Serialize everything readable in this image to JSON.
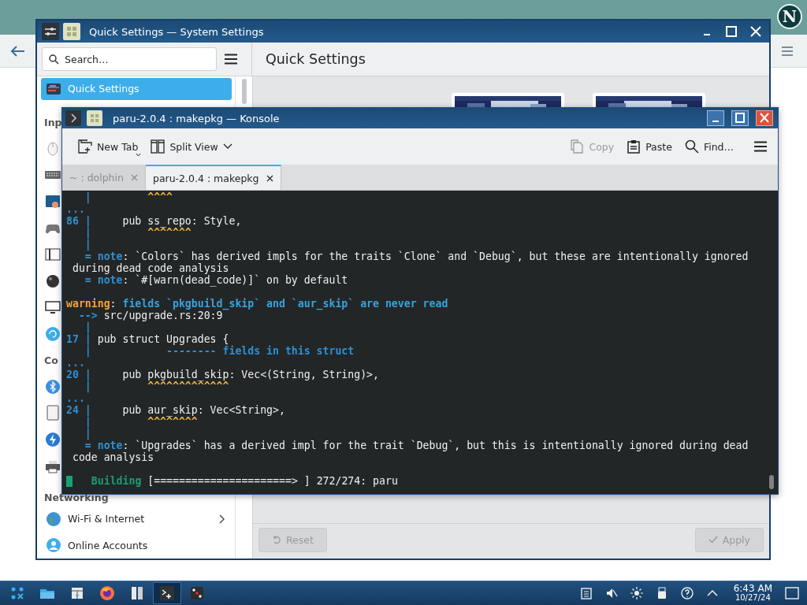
{
  "browser": {
    "avatar": "N"
  },
  "settings_window": {
    "title": "Quick Settings — System Settings",
    "search": {
      "placeholder": "Search…"
    },
    "page_title": "Quick Settings",
    "sidebar": [
      {
        "kind": "item",
        "label": "Quick Settings",
        "selected": true,
        "expandable": false
      },
      {
        "kind": "section",
        "label": "Inp"
      },
      {
        "kind": "item",
        "selected": false
      },
      {
        "kind": "item",
        "selected": false
      },
      {
        "kind": "item",
        "selected": false
      },
      {
        "kind": "item",
        "selected": false
      },
      {
        "kind": "item",
        "selected": false
      },
      {
        "kind": "item",
        "selected": false
      },
      {
        "kind": "item",
        "selected": false
      },
      {
        "kind": "item",
        "selected": false
      },
      {
        "kind": "section",
        "label": "Co"
      },
      {
        "kind": "item",
        "selected": false
      },
      {
        "kind": "item",
        "selected": false
      },
      {
        "kind": "item",
        "selected": false
      },
      {
        "kind": "item",
        "selected": false
      },
      {
        "kind": "section",
        "label": "Networking"
      },
      {
        "kind": "item",
        "label": "Wi-Fi & Internet",
        "selected": false,
        "expandable": true
      },
      {
        "kind": "item",
        "label": "Online Accounts",
        "selected": false,
        "expandable": false
      }
    ],
    "buttons": [
      {
        "label": "Reset",
        "disabled": true
      },
      {
        "label": "Apply",
        "disabled": true
      }
    ]
  },
  "konsole": {
    "title": "paru-2.0.4 : makepkg — Konsole",
    "toolbar_left": [
      {
        "label": "New Tab",
        "disabled": false
      },
      {
        "label": "Split View",
        "disabled": false
      }
    ],
    "toolbar_right": [
      {
        "label": "Copy",
        "disabled": true
      },
      {
        "label": "Paste",
        "disabled": false
      },
      {
        "label": "Find…",
        "disabled": false
      }
    ],
    "tabs": [
      {
        "label": "~ : dolphin",
        "selected": false
      },
      {
        "label": "paru-2.0.4 : makepkg",
        "selected": true
      }
    ],
    "lines": [
      {
        "kind": "text",
        "segments": [
          {
            "text": "   |",
            "kind": "gutter"
          },
          {
            "text": "         ^^^^",
            "kind": "caret"
          }
        ]
      },
      {
        "kind": "text",
        "segments": [
          {
            "text": "...",
            "kind": "gutter"
          }
        ]
      },
      {
        "kind": "text",
        "segments": [
          {
            "text": "86 |",
            "kind": "gutter"
          },
          {
            "text": "     pub ss_repo: Style,",
            "kind": "plain"
          }
        ]
      },
      {
        "kind": "text",
        "segments": [
          {
            "text": "   |",
            "kind": "gutter"
          },
          {
            "text": "         ^^^^^^^",
            "kind": "caret"
          }
        ]
      },
      {
        "kind": "text",
        "segments": [
          {
            "text": "   |",
            "kind": "gutter"
          }
        ]
      },
      {
        "kind": "text",
        "segments": [
          {
            "text": "   = ",
            "kind": "gutter"
          },
          {
            "text": "note",
            "kind": "note"
          },
          {
            "text": ": `Colors` has derived impls for the traits `Clone` and `Debug`, but these are intentionally ignored",
            "kind": "plain"
          }
        ]
      },
      {
        "kind": "text",
        "segments": [
          {
            "text": " during dead code analysis",
            "kind": "plain"
          }
        ]
      },
      {
        "kind": "text",
        "segments": [
          {
            "text": "   = ",
            "kind": "gutter"
          },
          {
            "text": "note",
            "kind": "note"
          },
          {
            "text": ": `#[warn(dead_code)]` on by default",
            "kind": "plain"
          }
        ]
      },
      {
        "kind": "blank"
      },
      {
        "kind": "text",
        "segments": [
          {
            "text": "warning",
            "kind": "warning"
          },
          {
            "text": ": ",
            "kind": "plain"
          },
          {
            "text": "fields `pkgbuild_skip` and `aur_skip` are never read",
            "kind": "message"
          }
        ]
      },
      {
        "kind": "text",
        "segments": [
          {
            "text": "  -->",
            "kind": "gutter"
          },
          {
            "text": " src/upgrade.rs:20:9",
            "kind": "plain"
          }
        ]
      },
      {
        "kind": "text",
        "segments": [
          {
            "text": "   |",
            "kind": "gutter"
          }
        ]
      },
      {
        "kind": "text",
        "segments": [
          {
            "text": "17 |",
            "kind": "gutter"
          },
          {
            "text": " pub struct Upgrades {",
            "kind": "plain"
          }
        ]
      },
      {
        "kind": "text",
        "segments": [
          {
            "text": "   |",
            "kind": "gutter"
          },
          {
            "text": "            -------- fields in this struct",
            "kind": "label"
          }
        ]
      },
      {
        "kind": "text",
        "segments": [
          {
            "text": "...",
            "kind": "gutter"
          }
        ]
      },
      {
        "kind": "text",
        "segments": [
          {
            "text": "20 |",
            "kind": "gutter"
          },
          {
            "text": "     pub pkgbuild_skip: Vec<(String, String)>,",
            "kind": "plain"
          }
        ]
      },
      {
        "kind": "text",
        "segments": [
          {
            "text": "   |",
            "kind": "gutter"
          },
          {
            "text": "         ^^^^^^^^^^^^^",
            "kind": "caret"
          }
        ]
      },
      {
        "kind": "text",
        "segments": [
          {
            "text": "...",
            "kind": "gutter"
          }
        ]
      },
      {
        "kind": "text",
        "segments": [
          {
            "text": "24 |",
            "kind": "gutter"
          },
          {
            "text": "     pub aur_skip: Vec<String>,",
            "kind": "plain"
          }
        ]
      },
      {
        "kind": "text",
        "segments": [
          {
            "text": "   |",
            "kind": "gutter"
          },
          {
            "text": "         ^^^^^^^^",
            "kind": "caret"
          }
        ]
      },
      {
        "kind": "text",
        "segments": [
          {
            "text": "   |",
            "kind": "gutter"
          }
        ]
      },
      {
        "kind": "text",
        "segments": [
          {
            "text": "   = ",
            "kind": "gutter"
          },
          {
            "text": "note",
            "kind": "note"
          },
          {
            "text": ": `Upgrades` has a derived impl for the trait `Debug`, but this is intentionally ignored during dead",
            "kind": "plain"
          }
        ]
      },
      {
        "kind": "text",
        "segments": [
          {
            "text": " code analysis",
            "kind": "plain"
          }
        ]
      },
      {
        "kind": "blank"
      },
      {
        "kind": "prompt",
        "segments": [
          {
            "text": "   Building",
            "kind": "progress"
          },
          {
            "text": " [======================> ] 272/274: paru",
            "kind": "plain"
          }
        ]
      }
    ]
  },
  "taskbar": {
    "items": [
      {
        "selected": false
      },
      {
        "selected": false
      },
      {
        "selected": false
      },
      {
        "selected": false
      },
      {
        "selected": false
      },
      {
        "selected": true
      },
      {
        "selected": false
      }
    ],
    "time": "6:43 AM",
    "date": "10/27/24"
  }
}
